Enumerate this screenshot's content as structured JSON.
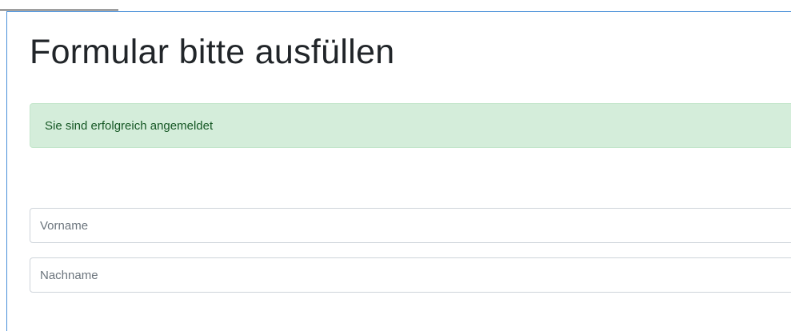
{
  "form": {
    "title": "Formular bitte ausfüllen",
    "success_message": "Sie sind erfolgreich angemeldet",
    "fields": [
      {
        "placeholder": "Vorname",
        "value": ""
      },
      {
        "placeholder": "Nachname",
        "value": ""
      }
    ]
  },
  "colors": {
    "panel_border": "#4a90d9",
    "alert_background": "#d4edda",
    "alert_text": "#155724",
    "title_text": "#212529"
  }
}
